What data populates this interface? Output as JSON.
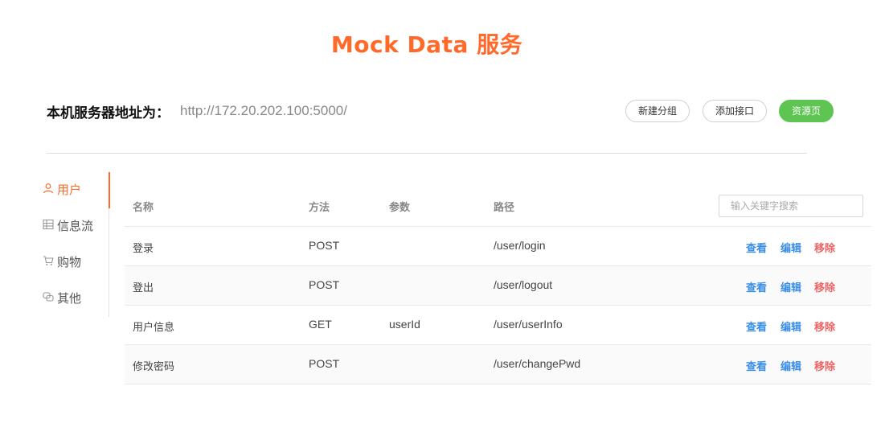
{
  "title": "Mock Data 服务",
  "server": {
    "label": "本机服务器地址为：",
    "url": "http://172.20.202.100:5000/"
  },
  "header_buttons": {
    "new_group": "新建分组",
    "add_api": "添加接口",
    "resource": "资源页"
  },
  "colors": {
    "accent": "#ff6a2b",
    "success": "#5ec552",
    "link": "#3a8ee6",
    "danger": "#f06262"
  },
  "sidebar": {
    "items": [
      {
        "label": "用户",
        "icon": "user-icon",
        "active": true
      },
      {
        "label": "信息流",
        "icon": "feed-icon",
        "active": false
      },
      {
        "label": "购物",
        "icon": "cart-icon",
        "active": false
      },
      {
        "label": "其他",
        "icon": "other-icon",
        "active": false
      }
    ]
  },
  "table": {
    "columns": {
      "name": "名称",
      "method": "方法",
      "params": "参数",
      "path": "路径"
    },
    "search_placeholder": "输入关键字搜索",
    "actions": {
      "view": "查看",
      "edit": "编辑",
      "remove": "移除"
    },
    "rows": [
      {
        "name": "登录",
        "method": "POST",
        "params": "",
        "path": "/user/login"
      },
      {
        "name": "登出",
        "method": "POST",
        "params": "",
        "path": "/user/logout"
      },
      {
        "name": "用户信息",
        "method": "GET",
        "params": "userId",
        "path": "/user/userInfo"
      },
      {
        "name": "修改密码",
        "method": "POST",
        "params": "",
        "path": "/user/changePwd"
      }
    ]
  }
}
